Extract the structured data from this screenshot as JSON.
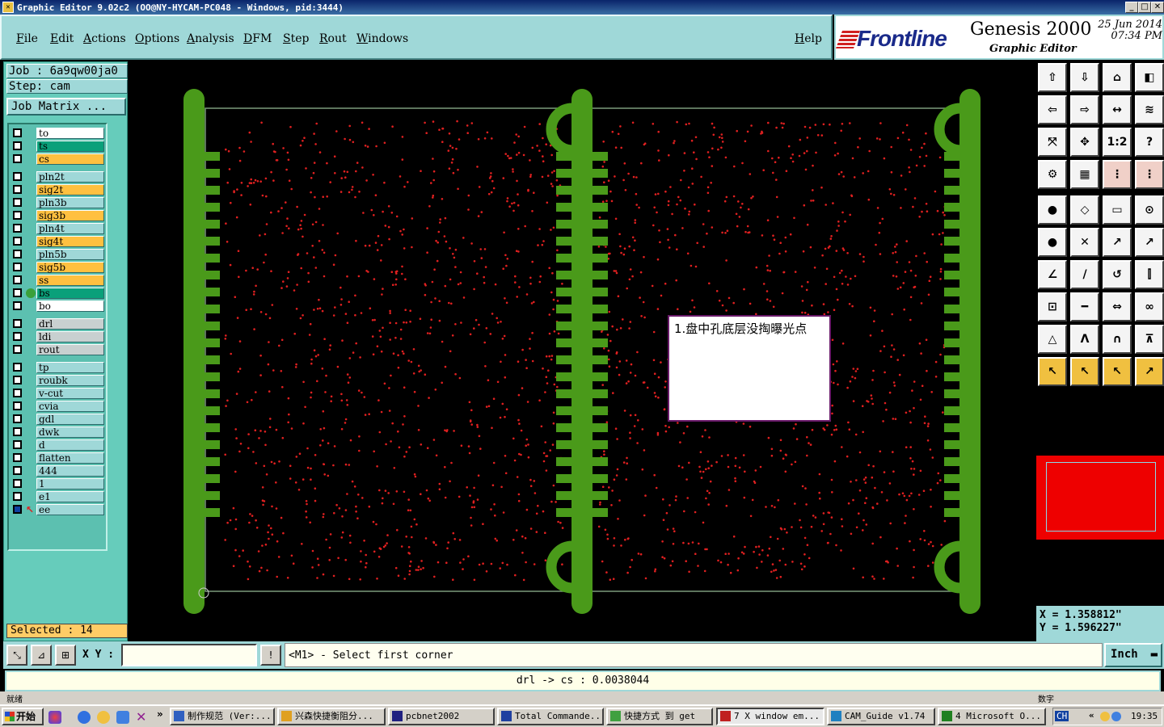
{
  "window": {
    "title": "Graphic Editor 9.02c2  (OO@NY-HYCAM-PC048 - Windows, pid:3444)"
  },
  "menu": [
    "File",
    "Edit",
    "Actions",
    "Options",
    "Analysis",
    "DFM",
    "Step",
    "Rout",
    "Windows"
  ],
  "help": "Help",
  "logo": {
    "brand": "Frontline",
    "product": "Genesis 2000",
    "subtitle": "Graphic Editor",
    "date": "25 Jun 2014",
    "time": "07:34 PM"
  },
  "job": {
    "job_label": "Job  :  6a9qw00ja0",
    "step_label": "Step: cam",
    "matrix_button": "Job Matrix ..."
  },
  "layers": [
    {
      "name": "to",
      "color": "#ffffff"
    },
    {
      "name": "ts",
      "color": "#0aa07a"
    },
    {
      "name": "cs",
      "color": "#ffc040"
    },
    {
      "name": "pln2t",
      "color": "#9fd8d8"
    },
    {
      "name": "sig2t",
      "color": "#ffc040"
    },
    {
      "name": "pln3b",
      "color": "#9fd8d8"
    },
    {
      "name": "sig3b",
      "color": "#ffc040"
    },
    {
      "name": "pln4t",
      "color": "#9fd8d8"
    },
    {
      "name": "sig4t",
      "color": "#ffc040"
    },
    {
      "name": "pln5b",
      "color": "#9fd8d8"
    },
    {
      "name": "sig5b",
      "color": "#ffc040"
    },
    {
      "name": "ss",
      "color": "#ffc040"
    },
    {
      "name": "bs",
      "color": "#0aa07a",
      "active": true
    },
    {
      "name": "bo",
      "color": "#ffffff"
    },
    {
      "name": "drl",
      "color": "#c8d0d0"
    },
    {
      "name": "ldi",
      "color": "#c8d0d0"
    },
    {
      "name": "rout",
      "color": "#c8d0d0"
    },
    {
      "name": "tp",
      "color": "#9fd8d8"
    },
    {
      "name": "roubk",
      "color": "#9fd8d8"
    },
    {
      "name": "v-cut",
      "color": "#9fd8d8"
    },
    {
      "name": "cvia",
      "color": "#9fd8d8"
    },
    {
      "name": "gdl",
      "color": "#9fd8d8"
    },
    {
      "name": "dwk",
      "color": "#9fd8d8"
    },
    {
      "name": "d",
      "color": "#9fd8d8"
    },
    {
      "name": "flatten",
      "color": "#9fd8d8"
    },
    {
      "name": "444",
      "color": "#9fd8d8"
    },
    {
      "name": "1",
      "color": "#9fd8d8"
    },
    {
      "name": "e1",
      "color": "#9fd8d8"
    },
    {
      "name": "ee",
      "color": "#9fd8d8",
      "work": true
    }
  ],
  "selected": "Selected : 14",
  "popup_note": "1.盘中孔底层没掏曝光点",
  "coords": {
    "x": "X = 1.358812\"",
    "y": "Y = 1.596227\""
  },
  "command": {
    "xy_label": "X Y :",
    "xy_value": "",
    "prompt": "<M1> - Select first corner",
    "unit": "Inch"
  },
  "status": "drl -> cs : 0.0038044",
  "strip": {
    "left": "就绪",
    "right": "数字"
  },
  "taskbar": {
    "start": "开始",
    "tasks": [
      "制作规范 (Ver:...",
      "兴森快捷衡阻分...",
      "pcbnet2002",
      "Total Commande...",
      "快捷方式 到 get",
      "7 X window em...",
      "CAM_Guide v1.74",
      "4 Microsoft O..."
    ],
    "lang": "CH",
    "clock": "19:35"
  },
  "colors": {
    "pcb_green": "#4a9a1a",
    "drill_dot": "#e02020",
    "panel_teal": "#9fd8d8"
  },
  "toolbar_icons": [
    "load-icon",
    "save-icon",
    "home-icon",
    "window-icon",
    "prev-icon",
    "next-icon",
    "mirror-icon",
    "route-icon",
    "fit-icon",
    "center-icon",
    "scale-1-2-icon",
    "query-icon",
    "snap-icon",
    "grid-icon",
    "layers-icon",
    "layers-alt-icon",
    "pad-icon",
    "draw-icon",
    "measure-icon",
    "dot-icon",
    "connect-icon",
    "cross-icon",
    "line-icon",
    "line-end-icon",
    "angle-icon",
    "slash-icon",
    "arc-icon",
    "step-icon",
    "move-icon",
    "minus-icon",
    "distance-icon",
    "rotate-icon",
    "triangle-icon",
    "apex-icon",
    "arch-icon",
    "bridge-icon",
    "pointer-icon",
    "select-icon",
    "select-alt-icon",
    "pointer-graph-icon"
  ]
}
